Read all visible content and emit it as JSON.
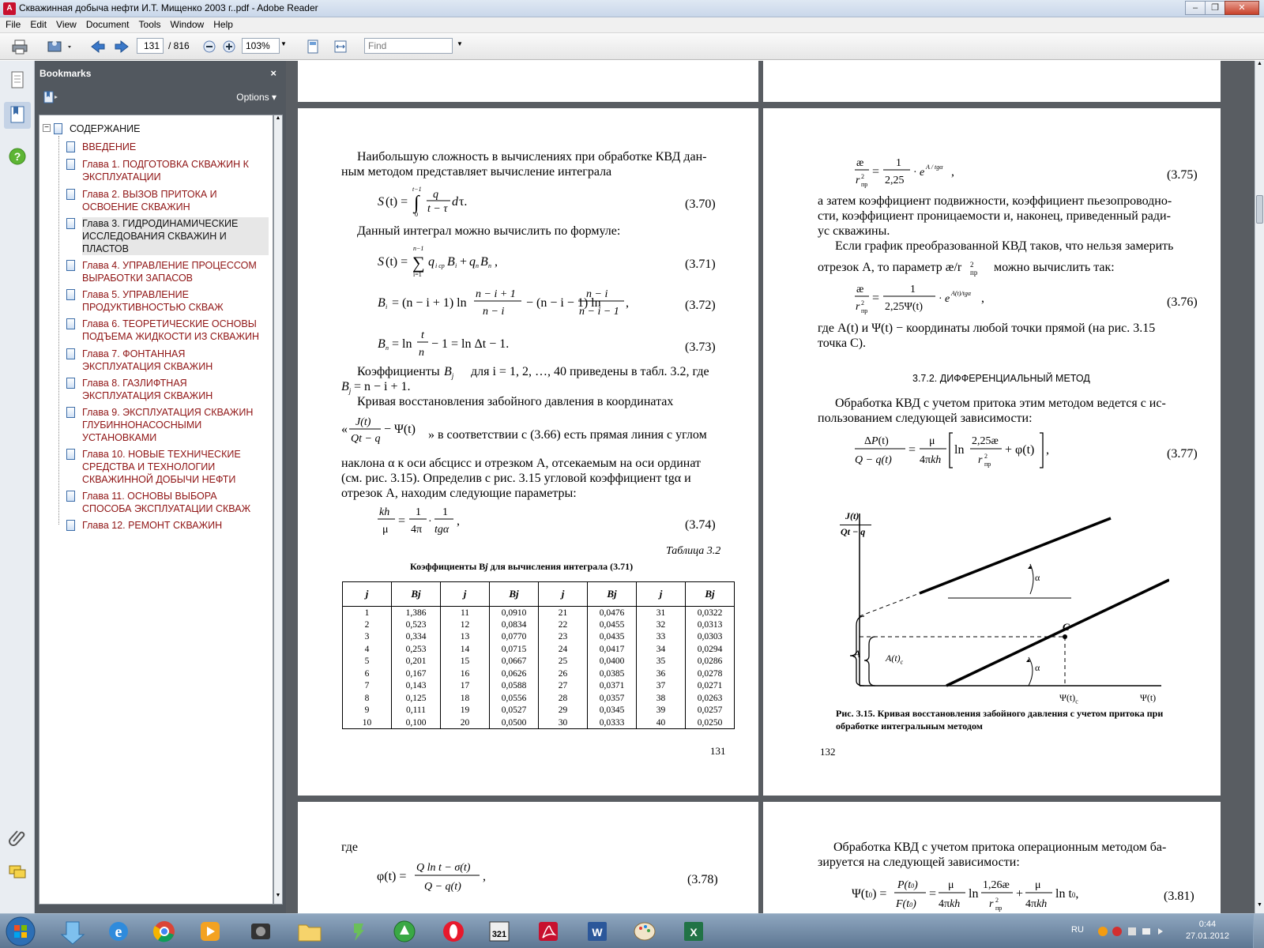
{
  "window": {
    "title": "Скважинная добыча нефти И.Т. Мищенко 2003 г..pdf - Adobe Reader",
    "app_icon": "pdf-icon"
  },
  "menu": [
    "File",
    "Edit",
    "View",
    "Document",
    "Tools",
    "Window",
    "Help"
  ],
  "toolbar": {
    "page_current": "131",
    "page_total": "/ 816",
    "zoom": "103%",
    "find_placeholder": "Find"
  },
  "bookmarks": {
    "title": "Bookmarks",
    "options": "Options",
    "items": [
      {
        "label": "СОДЕРЖАНИЕ",
        "root": true
      },
      {
        "label": "ВВЕДЕНИЕ"
      },
      {
        "label": "Глава 1. ПОДГОТОВКА СКВАЖИН К ЭКСПЛУАТАЦИИ"
      },
      {
        "label": "Глава 2. ВЫЗОВ ПРИТОКА И ОСВОЕНИЕ СКВАЖИН"
      },
      {
        "label": "Глава 3. ГИДРОДИНАМИЧЕСКИЕ ИССЛЕДОВАНИЯ СКВАЖИН И ПЛАСТОВ",
        "selected": true
      },
      {
        "label": "Глава 4. УПРАВЛЕНИЕ ПРОЦЕССОМ ВЫРАБОТКИ ЗАПАСОВ"
      },
      {
        "label": "Глава 5. УПРАВЛЕНИЕ ПРОДУКТИВНОСТЬЮ СКВАЖ"
      },
      {
        "label": "Глава 6. ТЕОРЕТИЧЕСКИЕ ОСНОВЫ ПОДЪЕМА ЖИДКОСТИ ИЗ СКВАЖИН"
      },
      {
        "label": "Глава 7. ФОНТАННАЯ ЭКСПЛУАТАЦИЯ СКВАЖИН"
      },
      {
        "label": "Глава 8. ГАЗЛИФТНАЯ ЭКСПЛУАТАЦИЯ СКВАЖИН"
      },
      {
        "label": "Глава 9. ЭКСПЛУАТАЦИЯ СКВАЖИН ГЛУБИННОНАСОСНЫМИ УСТАНОВКАМИ"
      },
      {
        "label": "Глава 10. НОВЫЕ ТЕХНИЧЕСКИЕ СРЕДСТВА И ТЕХНОЛОГИИ СКВАЖИННОЙ ДОБЫЧИ НЕФТИ"
      },
      {
        "label": "Глава 11. ОСНОВЫ ВЫБОРА СПОСОБА ЭКСПЛУАТАЦИИ СКВАЖ"
      },
      {
        "label": "Глава 12. РЕМОНТ СКВАЖИН"
      }
    ]
  },
  "page131": {
    "p1a": "Наибольшую сложность в вычислениях при обработке КВД дан-",
    "p1b": "ным методом представляет вычисление интеграла",
    "p2": "Данный интеграл можно вычислить по формуле:",
    "eq370": "(3.70)",
    "eq371": "(3.71)",
    "eq372": "(3.72)",
    "eq373": "(3.73)",
    "eq374": "(3.74)",
    "p3a": "Коэффициенты",
    "p3b": "для i = 1, 2, …, 40 приведены в табл. 3.2, где",
    "p3c": "= n − i + 1.",
    "p4a": "Кривая восстановления забойного давления в координатах",
    "p4b": "» в соответствии с (3.66) есть прямая линия с углом",
    "p4c": "наклона α к оси абсцисс и отрезком A, отсекаемым на оси ординат",
    "p4d": "(см. рис. 3.15). Определив с рис. 3.15 угловой коэффициент tgα и",
    "p4e": "отрезок A, находим следующие параметры:",
    "table_label": "Таблица 3.2",
    "table_caption": "Коэффициенты B",
    "table_caption2": " для вычисления интеграла (3.71)",
    "table_headers": [
      "j",
      "Bj",
      "j",
      "Bj",
      "j",
      "Bj",
      "j",
      "Bj"
    ],
    "table_rows": [
      [
        "1",
        "1,386",
        "11",
        "0,0910",
        "21",
        "0,0476",
        "31",
        "0,0322"
      ],
      [
        "2",
        "0,523",
        "12",
        "0,0834",
        "22",
        "0,0455",
        "32",
        "0,0313"
      ],
      [
        "3",
        "0,334",
        "13",
        "0,0770",
        "23",
        "0,0435",
        "33",
        "0,0303"
      ],
      [
        "4",
        "0,253",
        "14",
        "0,0715",
        "24",
        "0,0417",
        "34",
        "0,0294"
      ],
      [
        "5",
        "0,201",
        "15",
        "0,0667",
        "25",
        "0,0400",
        "35",
        "0,0286"
      ],
      [
        "6",
        "0,167",
        "16",
        "0,0626",
        "26",
        "0,0385",
        "36",
        "0,0278"
      ],
      [
        "7",
        "0,143",
        "17",
        "0,0588",
        "27",
        "0,0371",
        "37",
        "0,0271"
      ],
      [
        "8",
        "0,125",
        "18",
        "0,0556",
        "28",
        "0,0357",
        "38",
        "0,0263"
      ],
      [
        "9",
        "0,111",
        "19",
        "0,0527",
        "29",
        "0,0345",
        "39",
        "0,0257"
      ],
      [
        "10",
        "0,100",
        "20",
        "0,0500",
        "30",
        "0,0333",
        "40",
        "0,0250"
      ]
    ],
    "page_num": "131"
  },
  "page132": {
    "eq375": "(3.75)",
    "eq376": "(3.76)",
    "eq377": "(3.77)",
    "p1a": "а затем коэффициент подвижности, коэффициент пьезопроводно-",
    "p1b": "сти, коэффициент проницаемости и, наконец, приведенный ради-",
    "p1c": "ус скважины.",
    "p2a": "Если график преобразованной КВД таков, что нельзя замерить",
    "p2b": "отрезок A, то параметр æ/r",
    "p2c": "можно вычислить так:",
    "p3a": "где A(t) и  Ψ(t) − координаты любой точки прямой (на рис. 3.15",
    "p3b": "точка C).",
    "section": "3.7.2. ДИФФЕРЕНЦИАЛЬНЫЙ МЕТОД",
    "p4a": "Обработка КВД с учетом притока этим методом ведется с ис-",
    "p4b": "пользованием следующей зависимости:",
    "fig_caption1": "Рис. 3.15. Кривая восстановления забойного давления с учетом притока при",
    "fig_caption2": "обработке интегральным методом",
    "fig_axis_y": "J(t)",
    "fig_axis_y2": "Qt − q",
    "fig_alpha": "α",
    "fig_C": "C",
    "fig_A": "A",
    "fig_At": "A(t)",
    "fig_psic": "Ψ(t)",
    "fig_psi": "Ψ(t)",
    "page_num": "132"
  },
  "page133": {
    "p1": "где",
    "eq378": "(3.78)"
  },
  "page134": {
    "p1a": "Обработка КВД с учетом притока операционным методом ба-",
    "p1b": "зируется на следующей зависимости:",
    "eq381": "(3.81)"
  },
  "taskbar": {
    "lang": "RU",
    "time": "0:44",
    "date": "27.01.2012"
  }
}
